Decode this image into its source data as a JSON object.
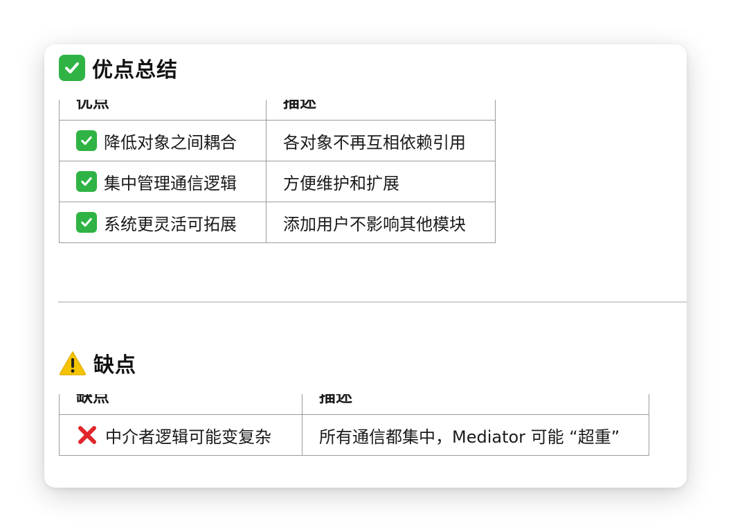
{
  "advantages": {
    "heading": "优点总结",
    "heading_icon": "check-mark-button-icon",
    "columns": [
      "优点",
      "描述"
    ],
    "rows": [
      {
        "icon": "check-mark-button-icon",
        "point": "降低对象之间耦合",
        "desc": "各对象不再互相依赖引用"
      },
      {
        "icon": "check-mark-button-icon",
        "point": "集中管理通信逻辑",
        "desc": "方便维护和扩展"
      },
      {
        "icon": "check-mark-button-icon",
        "point": "系统更灵活可拓展",
        "desc": "添加用户不影响其他模块"
      }
    ]
  },
  "disadvantages": {
    "heading": "缺点",
    "heading_icon": "warning-icon",
    "columns": [
      "缺点",
      "描述"
    ],
    "rows": [
      {
        "icon": "cross-mark-icon",
        "point": "中介者逻辑可能变复杂",
        "desc": "所有通信都集中，Mediator 可能 “超重”"
      }
    ]
  },
  "colors": {
    "check_green": "#2fb344",
    "cross_red": "#e0262b",
    "warning_yellow": "#f5c400"
  }
}
